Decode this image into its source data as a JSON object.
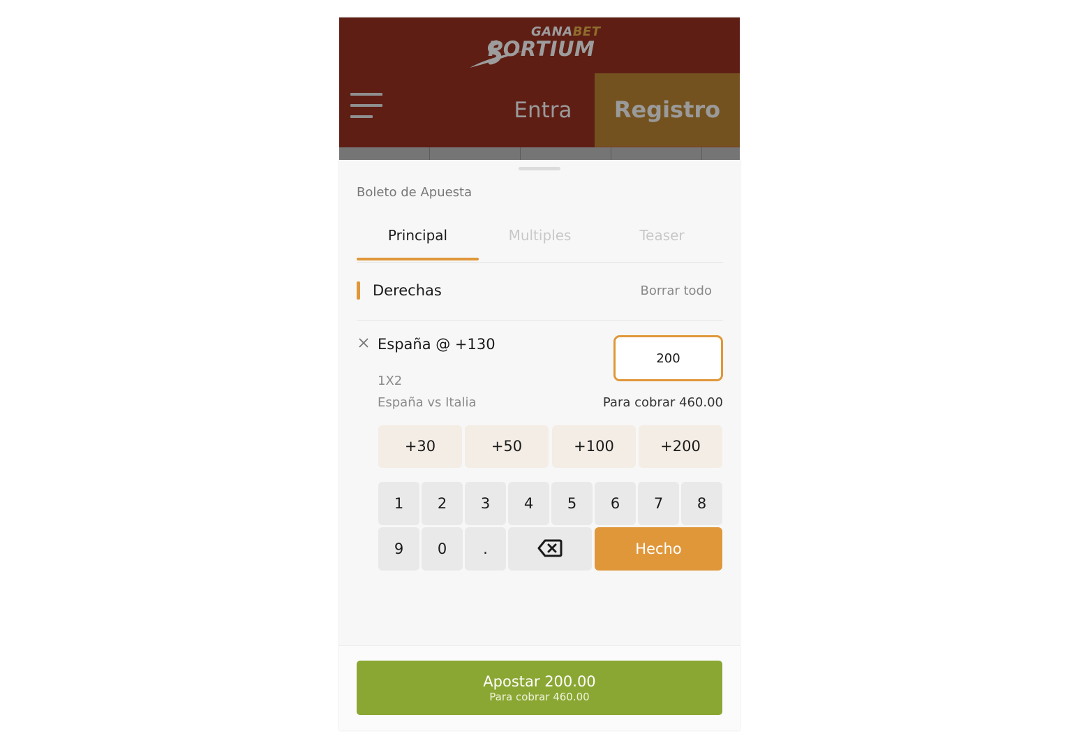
{
  "header": {
    "logo_top_a": "GANA",
    "logo_top_b": "BET",
    "logo_main": "PORTIUM",
    "login_label": "Entra",
    "register_label": "Registro"
  },
  "slip": {
    "title": "Boleto de Apuesta",
    "tabs": [
      {
        "label": "Principal",
        "active": true
      },
      {
        "label": "Multiples",
        "active": false
      },
      {
        "label": "Teaser",
        "active": false
      }
    ],
    "section_title": "Derechas",
    "clear_all": "Borrar todo",
    "selection": "España @ +130",
    "market": "1X2",
    "event": "España vs Italia",
    "stake_value": "200",
    "to_win": "Para cobrar 460.00"
  },
  "quick_amounts": [
    "+30",
    "+50",
    "+100",
    "+200"
  ],
  "keypad": {
    "keys": [
      "1",
      "2",
      "3",
      "4",
      "5",
      "6",
      "7",
      "8",
      "9",
      "0",
      "."
    ],
    "done_label": "Hecho"
  },
  "bet_button": {
    "label": "Apostar 200.00",
    "sub": "Para cobrar 460.00"
  },
  "colors": {
    "header_bg": "#5e1e14",
    "register_bg": "#74521f",
    "accent": "#e0973a",
    "bet_green": "#8ba733",
    "quick_bg": "#f3ede5",
    "key_bg": "#e9e9e9"
  }
}
